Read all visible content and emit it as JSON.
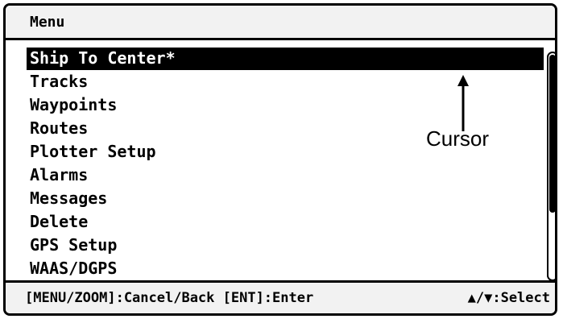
{
  "header": {
    "title": "Menu"
  },
  "menu": {
    "items": [
      {
        "label": "Ship To Center*",
        "selected": true
      },
      {
        "label": "Tracks",
        "selected": false
      },
      {
        "label": "Waypoints",
        "selected": false
      },
      {
        "label": "Routes",
        "selected": false
      },
      {
        "label": "Plotter Setup",
        "selected": false
      },
      {
        "label": "Alarms",
        "selected": false
      },
      {
        "label": "Messages",
        "selected": false
      },
      {
        "label": "Delete",
        "selected": false
      },
      {
        "label": "GPS Setup",
        "selected": false
      },
      {
        "label": "WAAS/DGPS",
        "selected": false
      }
    ]
  },
  "annotation": {
    "label": "Cursor"
  },
  "footer": {
    "hint": "[MENU/ZOOM]:Cancel/Back [ENT]:Enter",
    "select": "▲/▼:Select"
  }
}
